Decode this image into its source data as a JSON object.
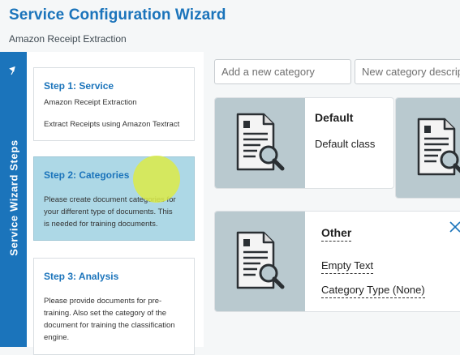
{
  "header": {
    "title": "Service Configuration Wizard",
    "subtitle": "Amazon Receipt Extraction"
  },
  "sidebar": {
    "tab_label": "Service Wizard Steps",
    "steps": [
      {
        "title": "Step 1: Service",
        "lines": [
          "Amazon Receipt Extraction",
          "Extract Receipts using Amazon Textract"
        ],
        "active": false
      },
      {
        "title": "Step 2: Categories",
        "lines": [
          "Please create document categories for",
          "your different type of documents. This",
          "is needed for training documents."
        ],
        "active": true
      },
      {
        "title": "Step 3: Analysis",
        "lines": [
          "Please provide documents for pre-",
          "training. Also set the category of the",
          "document for training the classification",
          "engine."
        ],
        "active": false
      }
    ]
  },
  "category_form": {
    "name_placeholder": "Add a new category",
    "description_placeholder": "New category description"
  },
  "categories": [
    {
      "title": "Default",
      "description": "Default class",
      "icon": "document-search-icon"
    },
    {
      "title": "Other",
      "text": "Empty Text",
      "type": "Category Type (None)",
      "icon": "document-search-icon"
    }
  ],
  "colors": {
    "accent": "#1b74bb",
    "active_step": "#add8e6",
    "card_image_bg": "#b9c9cf"
  }
}
